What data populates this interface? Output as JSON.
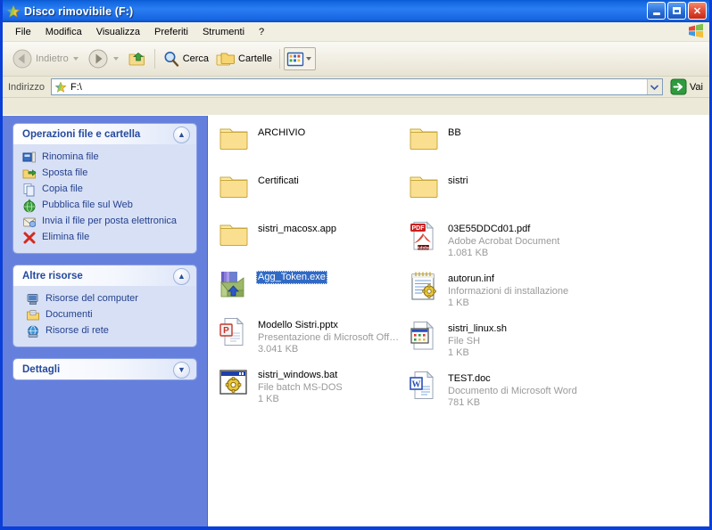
{
  "window": {
    "title": "Disco rimovibile (F:)",
    "icon": "removable-disk-star-icon",
    "buttons": {
      "minimize": "Riduci a icona",
      "maximize": "Ingrandisci",
      "close": "Chiudi"
    }
  },
  "menubar": {
    "items": [
      {
        "label": "File"
      },
      {
        "label": "Modifica"
      },
      {
        "label": "Visualizza"
      },
      {
        "label": "Preferiti"
      },
      {
        "label": "Strumenti"
      },
      {
        "label": "?"
      }
    ],
    "brand_icon": "windows-flag-icon"
  },
  "toolbar": {
    "back": {
      "label": "Indietro",
      "icon": "back-arrow-icon",
      "disabled": true
    },
    "forward": {
      "label": "",
      "icon": "forward-arrow-icon",
      "disabled": false
    },
    "up": {
      "label": "",
      "icon": "up-folder-icon"
    },
    "search": {
      "label": "Cerca",
      "icon": "magnifier-icon"
    },
    "folders": {
      "label": "Cartelle",
      "icon": "folders-icon"
    },
    "views": {
      "label": "",
      "icon": "views-icon"
    }
  },
  "address": {
    "label": "Indirizzo",
    "value": "F:\\",
    "icon": "removable-disk-star-icon",
    "go_label": "Vai",
    "go_icon": "go-arrow-icon"
  },
  "sidebar": {
    "panels": [
      {
        "title": "Operazioni file e cartella",
        "state": "expanded",
        "chevron": "chevron-up-icon",
        "items": [
          {
            "label": "Rinomina file",
            "icon": "rename-icon"
          },
          {
            "label": "Sposta file",
            "icon": "move-folder-icon"
          },
          {
            "label": "Copia file",
            "icon": "copy-page-icon"
          },
          {
            "label": "Pubblica file sul Web",
            "icon": "publish-web-icon"
          },
          {
            "label": "Invia il file per posta elettronica",
            "icon": "mail-icon"
          },
          {
            "label": "Elimina file",
            "icon": "delete-x-icon"
          }
        ]
      },
      {
        "title": "Altre risorse",
        "state": "expanded",
        "chevron": "chevron-up-icon",
        "items": [
          {
            "label": "Risorse del computer",
            "icon": "my-computer-icon"
          },
          {
            "label": "Documenti",
            "icon": "documents-folder-icon"
          },
          {
            "label": "Risorse di rete",
            "icon": "network-icon"
          }
        ]
      },
      {
        "title": "Dettagli",
        "state": "collapsed",
        "chevron": "chevron-down-icon",
        "items": []
      }
    ]
  },
  "files": {
    "view": "tiles",
    "left_column": [
      {
        "name": "ARCHIVIO",
        "type": "",
        "size": "",
        "icon": "folder-icon",
        "selected": false
      },
      {
        "name": "Certificati",
        "type": "",
        "size": "",
        "icon": "folder-icon",
        "selected": false
      },
      {
        "name": "sistri_macosx.app",
        "type": "",
        "size": "",
        "icon": "folder-icon",
        "selected": false
      },
      {
        "name": "Agg_Token.exe",
        "type": "",
        "size": "",
        "icon": "installer-exe-icon",
        "selected": true
      },
      {
        "name": "Modello Sistri.pptx",
        "type": "Presentazione di Microsoft Off…",
        "size": "3.041 KB",
        "icon": "powerpoint-icon",
        "selected": false
      },
      {
        "name": "sistri_windows.bat",
        "type": "File batch MS-DOS",
        "size": "1 KB",
        "icon": "bat-gear-icon",
        "selected": false
      }
    ],
    "right_column": [
      {
        "name": "BB",
        "type": "",
        "size": "",
        "icon": "folder-icon",
        "selected": false
      },
      {
        "name": "sistri",
        "type": "",
        "size": "",
        "icon": "folder-icon",
        "selected": false
      },
      {
        "name": "03E55DDCd01.pdf",
        "type": "Adobe Acrobat Document",
        "size": "1.081 KB",
        "icon": "pdf-icon",
        "selected": false
      },
      {
        "name": "autorun.inf",
        "type": "Informazioni di installazione",
        "size": "1 KB",
        "icon": "inf-notepad-gear-icon",
        "selected": false
      },
      {
        "name": "sistri_linux.sh",
        "type": "File SH",
        "size": "1 KB",
        "icon": "sh-icon",
        "selected": false
      },
      {
        "name": "TEST.doc",
        "type": "Documento di Microsoft Word",
        "size": "781 KB",
        "icon": "word-icon",
        "selected": false
      }
    ]
  },
  "colors": {
    "titlebar_blue": "#1267e0",
    "sidebar_blue": "#6580dc",
    "panel_body": "#d8e0f6",
    "panel_title_text": "#254a9e",
    "selection": "#316ac5",
    "chrome": "#ece9d8"
  }
}
